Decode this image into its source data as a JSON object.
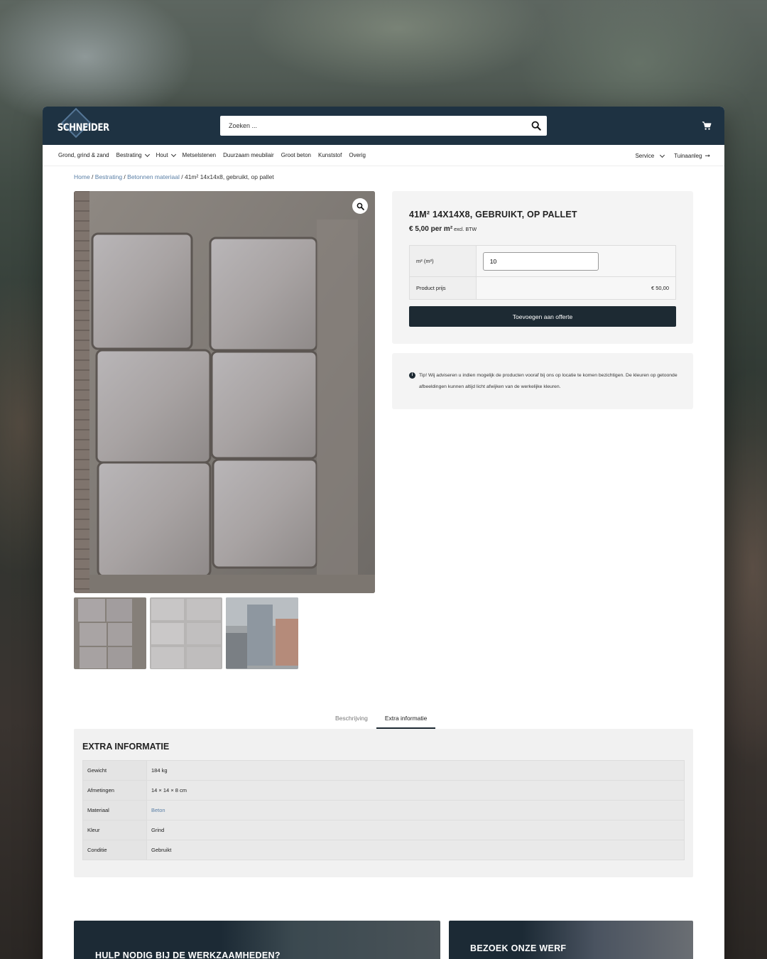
{
  "header": {
    "logo_text": "SCHNEIDER",
    "search_placeholder": "Zoeken ..."
  },
  "nav": {
    "items": [
      {
        "label": "Grond, grind & zand"
      },
      {
        "label": "Bestrating"
      },
      {
        "label": "Hout"
      },
      {
        "label": "Metselstenen"
      },
      {
        "label": "Duurzaam meubilair"
      },
      {
        "label": "Groot beton"
      },
      {
        "label": "Kunststof"
      },
      {
        "label": "Overig"
      }
    ],
    "service": "Service",
    "tuinaanleg": "Tuinaanleg"
  },
  "breadcrumb": {
    "home": "Home",
    "bestrating": "Bestrating",
    "category": "Betonnen materiaal",
    "current": "41m² 14x14x8, gebruikt, op pallet"
  },
  "product": {
    "title": "41M² 14X14X8, GEBRUIKT, OP PALLET",
    "price": "€ 5,00 per m²",
    "price_suffix": "excl. BTW",
    "qty_label": "m² (m²)",
    "qty_value": "10",
    "product_price_label": "Product prijs",
    "product_price_value": "€ 50,00",
    "add_button": "Toevoegen aan offerte",
    "tip": "Tip! Wij adviseren u indien mogelijk de producten vooraf bij ons op locatie te komen bezichtigen. De kleuren op getoonde afbeeldingen kunnen altijd licht afwijken van de werkelijke kleuren."
  },
  "tabs": {
    "description": "Beschrijving",
    "extra": "Extra informatie"
  },
  "extra_info": {
    "heading": "EXTRA INFORMATIE",
    "rows": [
      {
        "key": "Gewicht",
        "value": "184 kg"
      },
      {
        "key": "Afmetingen",
        "value": "14 × 14 × 8 cm"
      },
      {
        "key": "Materiaal",
        "value": "Beton"
      },
      {
        "key": "Kleur",
        "value": "Grind"
      },
      {
        "key": "Conditie",
        "value": "Gebruikt"
      }
    ]
  },
  "promos": {
    "help": "HULP NODIG BIJ DE WERKZAAMHEDEN?",
    "visit": "BEZOEK ONZE WERF"
  },
  "colors": {
    "header_bg": "#1e3242",
    "button_bg": "#1d2a33",
    "link": "#5a7fa6"
  }
}
